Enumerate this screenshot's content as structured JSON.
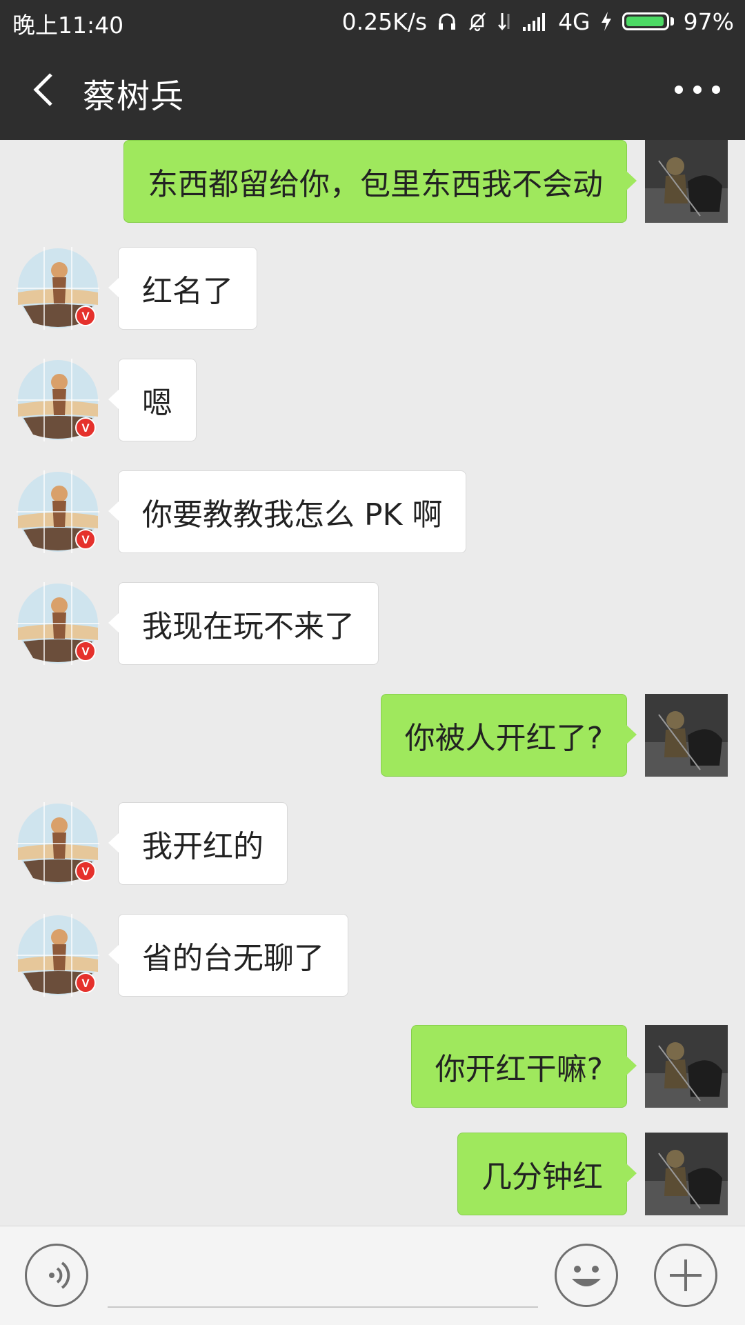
{
  "status_bar": {
    "time": "晚上11:40",
    "speed": "0.25K/s",
    "network": "4G",
    "battery": "97%",
    "battery_level": 0.97
  },
  "header": {
    "title": "蔡树兵",
    "back_icon": "chevron-left-icon",
    "more_icon": "more-dots-icon"
  },
  "messages": [
    {
      "side": "out",
      "text": "东西都留给你，包里东西我不会动"
    },
    {
      "side": "in",
      "text": "红名了"
    },
    {
      "side": "in",
      "text": "嗯"
    },
    {
      "side": "in",
      "text": "你要教教我怎么 PK 啊"
    },
    {
      "side": "in",
      "text": "我现在玩不来了"
    },
    {
      "side": "out",
      "text": "你被人开红了?"
    },
    {
      "side": "in",
      "text": "我开红的"
    },
    {
      "side": "in",
      "text": "省的台无聊了"
    },
    {
      "side": "out",
      "text": "你开红干嘛?"
    },
    {
      "side": "out",
      "text": "几分钟红"
    }
  ],
  "input_bar": {
    "voice_icon": "voice-icon",
    "emoji_icon": "emoji-icon",
    "plus_icon": "plus-icon"
  },
  "colors": {
    "nav_bg": "#2e2e2e",
    "chat_bg": "#ebebeb",
    "outgoing_bubble": "#9fe85d",
    "incoming_bubble": "#ffffff",
    "verified_badge": "#e5312c"
  }
}
